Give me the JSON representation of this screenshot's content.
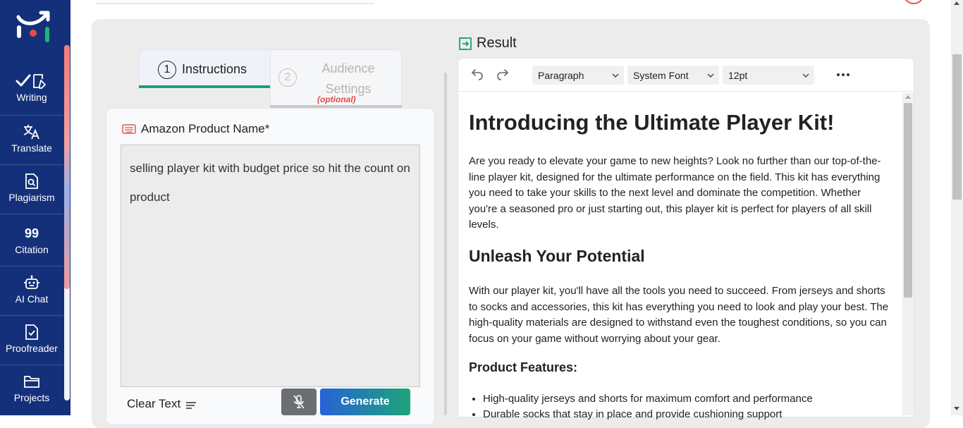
{
  "sidebar": {
    "items": [
      {
        "label": "Writing",
        "icon": "writing-icon"
      },
      {
        "label": "Translate",
        "icon": "translate-icon"
      },
      {
        "label": "Plagiarism",
        "icon": "plagiarism-icon"
      },
      {
        "label": "Citation",
        "icon": "quote-icon",
        "glyph": "99"
      },
      {
        "label": "AI Chat",
        "icon": "robot-icon"
      },
      {
        "label": "Proofreader",
        "icon": "proofread-icon"
      },
      {
        "label": "Projects",
        "icon": "folder-icon"
      }
    ]
  },
  "tabs": {
    "instructions": {
      "step": "1",
      "label": "Instructions"
    },
    "audience": {
      "step": "2",
      "label": "Audience Settings",
      "optional": "(optional)"
    }
  },
  "form": {
    "field_label": "Amazon Product Name*",
    "input_value": "selling player kit with budget price so hit the count on product",
    "clear_label": "Clear Text",
    "generate_label": "Generate"
  },
  "result": {
    "heading": "Result",
    "toolbar": {
      "block_format": "Paragraph",
      "font_family": "System Font",
      "font_size": "12pt"
    },
    "content": {
      "h1": "Introducing the Ultimate Player Kit!",
      "p1": "Are you ready to elevate your game to new heights? Look no further than our top-of-the-line player kit, designed for the ultimate performance on the field. This kit has everything you need to take your skills to the next level and dominate the competition. Whether you're a seasoned pro or just starting out, this player kit is perfect for players of all skill levels.",
      "h2": "Unleash Your Potential",
      "p2": "With our player kit, you'll have all the tools you need to succeed. From jerseys and shorts to socks and accessories, this kit has everything you need to look and play your best. The high-quality materials are designed to withstand even the toughest conditions, so you can focus on your game without worrying about your gear.",
      "h3": "Product Features:",
      "features": [
        "High-quality jerseys and shorts for maximum comfort and performance",
        "Durable socks that stay in place and provide cushioning support"
      ]
    }
  },
  "colors": {
    "sidebar": "#14307a",
    "accent_green": "#1aa36b",
    "generate_start": "#2762d8",
    "generate_end": "#1ea47a",
    "optional_red": "#e24a4a"
  }
}
